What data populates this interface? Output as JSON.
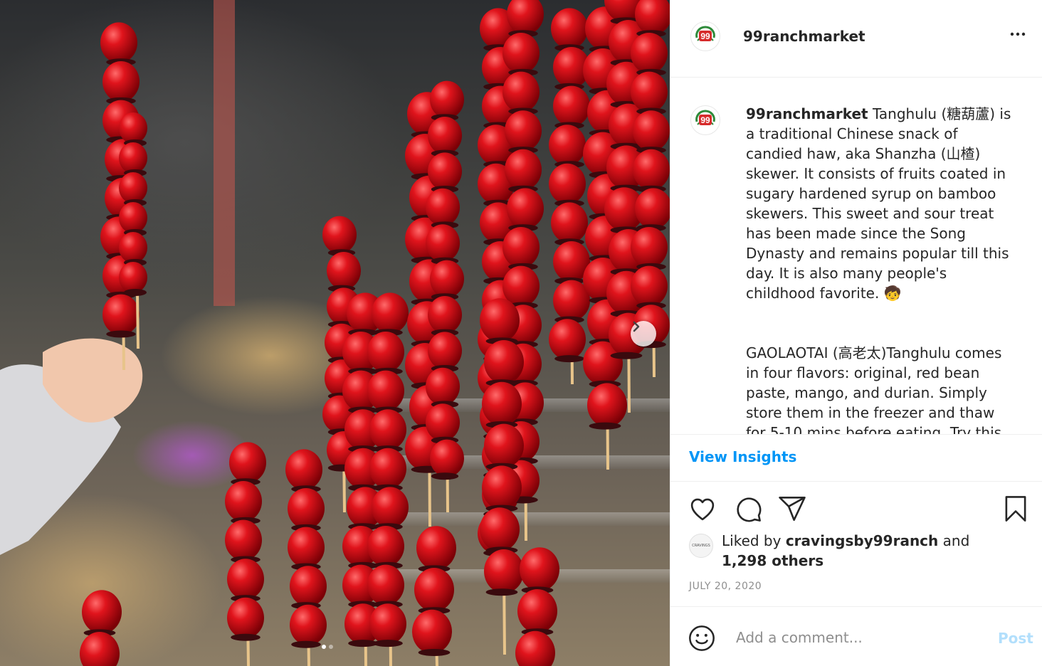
{
  "colors": {
    "accent": "#0095f6",
    "post_disabled": "#b2dffc",
    "text": "#262626",
    "muted": "#8e8e8e",
    "logo_red": "#d62b2b",
    "logo_green": "#2e8b3a"
  },
  "post": {
    "image_alt": "Tanghulu skewers of candied red fruit",
    "carousel": {
      "current": 1,
      "total": 2
    },
    "next_icon": "chevron-right-icon"
  },
  "header": {
    "logo_text": "99",
    "username": "99ranchmarket",
    "more_icon": "more-horizontal-icon",
    "more_label": "•••"
  },
  "caption": {
    "username": "99ranchmarket",
    "paragraph1": "Tanghulu (糖葫蘆) is a traditional Chinese snack of candied haw, aka Shanzha (山楂) skewer. It consists of fruits coated in sugary hardened syrup on bamboo skewers. This sweet and sour treat has been made since the Song Dynasty and remains popular till this day. It is also many people's childhood favorite. 🧒",
    "paragraph2": "GAOLAOTAI (高老太)Tanghulu comes in four flavors: original, red bean paste, mango, and durian. Simply store them in the freezer and thaw for 5-10 mins before eating. Try this pretty and classic treat yourself and"
  },
  "insights_label": "View Insights",
  "actions": [
    "heart-icon",
    "comment-icon",
    "share-icon",
    "bookmark-icon"
  ],
  "likes": {
    "avatar_text": "CRAVINGS",
    "prefix": "Liked by",
    "liker": "cravingsby99ranch",
    "and": "and",
    "others": "1,298 others"
  },
  "date": "JULY 20, 2020",
  "comment": {
    "placeholder": "Add a comment...",
    "post_label": "Post",
    "emoji_icon": "smiley-icon"
  }
}
